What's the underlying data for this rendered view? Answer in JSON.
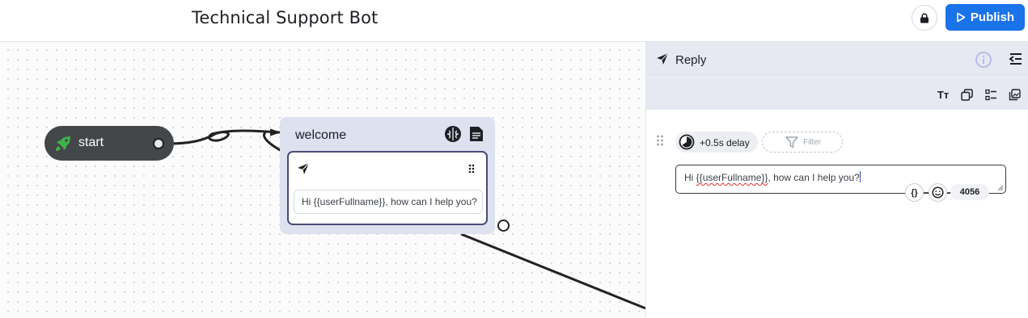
{
  "header": {
    "title": "Technical Support Bot",
    "publish_label": "Publish",
    "lock_icon": "lock-icon",
    "publish_icon": "play-outline-icon"
  },
  "canvas": {
    "start_node": {
      "label": "start",
      "icon": "rocket-icon"
    },
    "welcome_node": {
      "label": "welcome",
      "icons": [
        "brain-icon",
        "document-icon"
      ],
      "message_preview": "Hi {{userFullname}}, how can I help you?"
    }
  },
  "panel": {
    "title": "Reply",
    "toolbar": {
      "text_format": "Tт"
    },
    "delay_label": "+0.5s delay",
    "filter_label": "Filter",
    "reply_prefix": "Hi ",
    "reply_variable": "{{userFullname}}",
    "reply_suffix": ", how can I help you?",
    "variable_button": "{}",
    "char_count": "4056"
  },
  "colors": {
    "accent": "#1a73e8",
    "node_header": "#dde1f0",
    "panel_header": "#e6e9f2",
    "start_node": "#434749",
    "card_border": "#474d78"
  }
}
